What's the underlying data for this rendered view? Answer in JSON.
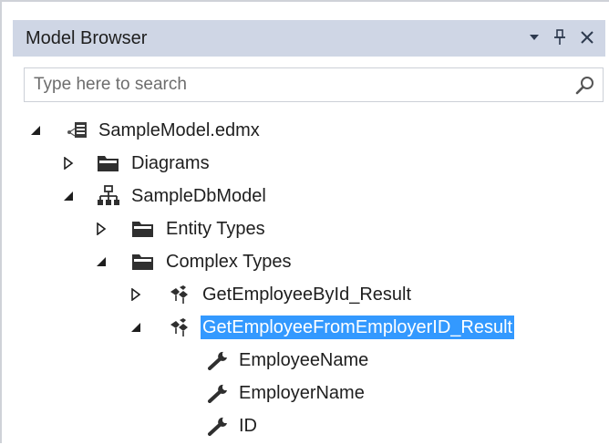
{
  "panel": {
    "title": "Model Browser",
    "controls": {
      "dropdown_icon": "dropdown-triangle-icon",
      "pin_icon": "pin-icon",
      "close_icon": "close-icon"
    }
  },
  "search": {
    "placeholder": "Type here to search",
    "value": "",
    "icon": "search-icon"
  },
  "colors": {
    "titlebar_bg": "#cfd6e5",
    "selection_bg": "#3399ff",
    "selection_text": "#ffffff"
  },
  "tree": {
    "root": {
      "label": "SampleModel.edmx",
      "icon": "edmx-file-icon",
      "expanded": true
    },
    "diagrams": {
      "label": "Diagrams",
      "icon": "folder-icon",
      "expanded": false
    },
    "model": {
      "label": "SampleDbModel",
      "icon": "model-hierarchy-icon",
      "expanded": true
    },
    "entity_types": {
      "label": "Entity Types",
      "icon": "folder-icon",
      "expanded": false
    },
    "complex_types": {
      "label": "Complex Types",
      "icon": "folder-icon",
      "expanded": true
    },
    "complex_items": [
      {
        "label": "GetEmployeeById_Result",
        "icon": "complex-type-icon",
        "expanded": false,
        "selected": false
      },
      {
        "label": "GetEmployeeFromEmployerID_Result",
        "icon": "complex-type-icon",
        "expanded": true,
        "selected": true
      }
    ],
    "properties": [
      {
        "label": "EmployeeName",
        "icon": "wrench-icon"
      },
      {
        "label": "EmployerName",
        "icon": "wrench-icon"
      },
      {
        "label": "ID",
        "icon": "wrench-icon"
      }
    ]
  }
}
